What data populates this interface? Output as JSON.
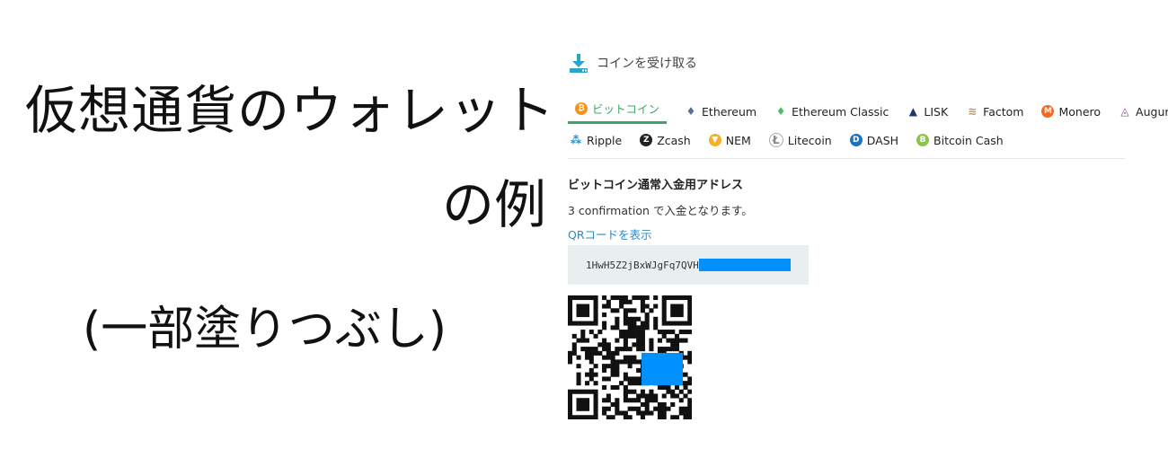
{
  "caption": {
    "line1": "仮想通貨のウォレット",
    "line2": "の例",
    "line3": "(一部塗りつぶし)"
  },
  "panel": {
    "title": "コインを受け取る",
    "icon": "download-icon",
    "accent_color": "#3aa864",
    "link_color": "#2a8ac9",
    "redact_color": "#0091ff"
  },
  "tabs_row1": [
    {
      "label": "ビットコイン",
      "icon": "bitcoin-icon",
      "active": true
    },
    {
      "label": "Ethereum",
      "icon": "ethereum-icon",
      "active": false
    },
    {
      "label": "Ethereum Classic",
      "icon": "ethereum-classic-icon",
      "active": false
    },
    {
      "label": "LISK",
      "icon": "lisk-icon",
      "active": false
    },
    {
      "label": "Factom",
      "icon": "factom-icon",
      "active": false
    },
    {
      "label": "Monero",
      "icon": "monero-icon",
      "active": false
    },
    {
      "label": "Augur",
      "icon": "augur-icon",
      "active": false
    }
  ],
  "tabs_row2": [
    {
      "label": "Ripple",
      "icon": "ripple-icon",
      "active": false
    },
    {
      "label": "Zcash",
      "icon": "zcash-icon",
      "active": false
    },
    {
      "label": "NEM",
      "icon": "nem-icon",
      "active": false
    },
    {
      "label": "Litecoin",
      "icon": "litecoin-icon",
      "active": false
    },
    {
      "label": "DASH",
      "icon": "dash-icon",
      "active": false
    },
    {
      "label": "Bitcoin Cash",
      "icon": "bitcoin-cash-icon",
      "active": false
    }
  ],
  "deposit": {
    "title": "ビットコイン通常入金用アドレス",
    "confirmation": "3 confirmation で入金となります。",
    "qr_link": "QRコードを表示",
    "address_visible": "1HwH5Z2jBxWJgFq7QVH"
  }
}
